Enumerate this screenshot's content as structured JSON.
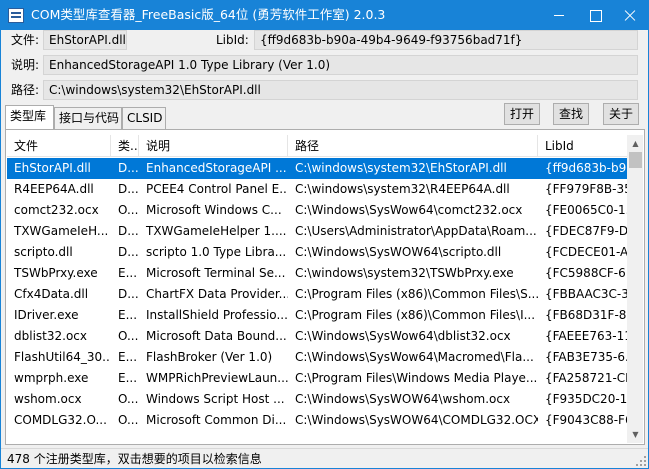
{
  "window": {
    "title": "COM类型库查看器_FreeBasic版_64位 (勇芳软件工作室) 2.0.3",
    "icon": "app-icon"
  },
  "info": {
    "file_label": "文件:",
    "file_value": "EhStorAPI.dll",
    "libid_label": "LibId:",
    "libid_value": "{ff9d683b-b90a-49b4-9649-f93756bad71f}",
    "desc_label": "说明:",
    "desc_value": "EnhancedStorageAPI 1.0 Type Library (Ver 1.0)",
    "path_label": "路径:",
    "path_value": "C:\\windows\\system32\\EhStorAPI.dll"
  },
  "tabs": [
    {
      "label": "类型库"
    },
    {
      "label": "接口与代码"
    },
    {
      "label": "CLSID"
    }
  ],
  "buttons": {
    "open": "打开",
    "find": "查找",
    "about": "关于"
  },
  "table": {
    "columns": [
      "文件",
      "类...",
      "说明",
      "路径",
      "LibId"
    ],
    "rows": [
      [
        "EhStorAPI.dll",
        "D...",
        "EnhancedStorageAPI ...",
        "C:\\windows\\system32\\EhStorAPI.dll",
        "{ff9d683b-b9..."
      ],
      [
        "R4EEP64A.dll",
        "D...",
        "PCEE4 Control Panel E...",
        "C:\\windows\\system32\\R4EEP64A.dll",
        "{FF979F8B-35..."
      ],
      [
        "comct232.ocx",
        "O...",
        "Microsoft Windows C...",
        "C:\\Windows\\SysWow64\\comct232.ocx",
        "{FE0065C0-1..."
      ],
      [
        "TXWGameIeH...",
        "D...",
        "TXWGameIeHelper 1....",
        "C:\\Users\\Administrator\\AppData\\Roam...",
        "{FDEC87F9-D..."
      ],
      [
        "scripto.dll",
        "D...",
        "scripto 1.0 Type Libra...",
        "C:\\Windows\\SysWOW64\\scripto.dll",
        "{FCDECE01-A..."
      ],
      [
        "TSWbPrxy.exe",
        "E...",
        "Microsoft Terminal Se...",
        "C:\\windows\\system32\\TSWbPrxy.exe",
        "{FC5988CF-6..."
      ],
      [
        "Cfx4Data.dll",
        "D...",
        "ChartFX Data Provider...",
        "C:\\Program Files (x86)\\Common Files\\S...",
        "{FBBAAC3C-3..."
      ],
      [
        "IDriver.exe",
        "E...",
        "InstallShield Professio...",
        "C:\\Program Files (x86)\\Common Files\\I...",
        "{FB68D31F-8..."
      ],
      [
        "dblist32.ocx",
        "O...",
        "Microsoft Data Bound...",
        "C:\\Windows\\SysWow64\\dblist32.ocx",
        "{FAEEE763-11..."
      ],
      [
        "FlashUtil64_30...",
        "E...",
        "FlashBroker (Ver 1.0)",
        "C:\\Windows\\SysWow64\\Macromed\\Fla...",
        "{FAB3E735-6..."
      ],
      [
        "wmprph.exe",
        "E...",
        "WMPRichPreviewLaun...",
        "C:\\Program Files\\Windows Media Playe...",
        "{FA258721-CF..."
      ],
      [
        "wshom.ocx",
        "O...",
        "Windows Script Host ...",
        "C:\\Windows\\SysWOW64\\wshom.ocx",
        "{F935DC20-1..."
      ],
      [
        "COMDLG32.O...",
        "O...",
        "Microsoft Common Di...",
        "C:\\Windows\\SysWOW64\\COMDLG32.OCX",
        "{F9043C88-F6..."
      ]
    ]
  },
  "status": {
    "text": "478 个注册类型库，双击想要的项目以检索信息"
  },
  "colors": {
    "titlebar": "#1883d7",
    "selection": "#0078d7"
  }
}
